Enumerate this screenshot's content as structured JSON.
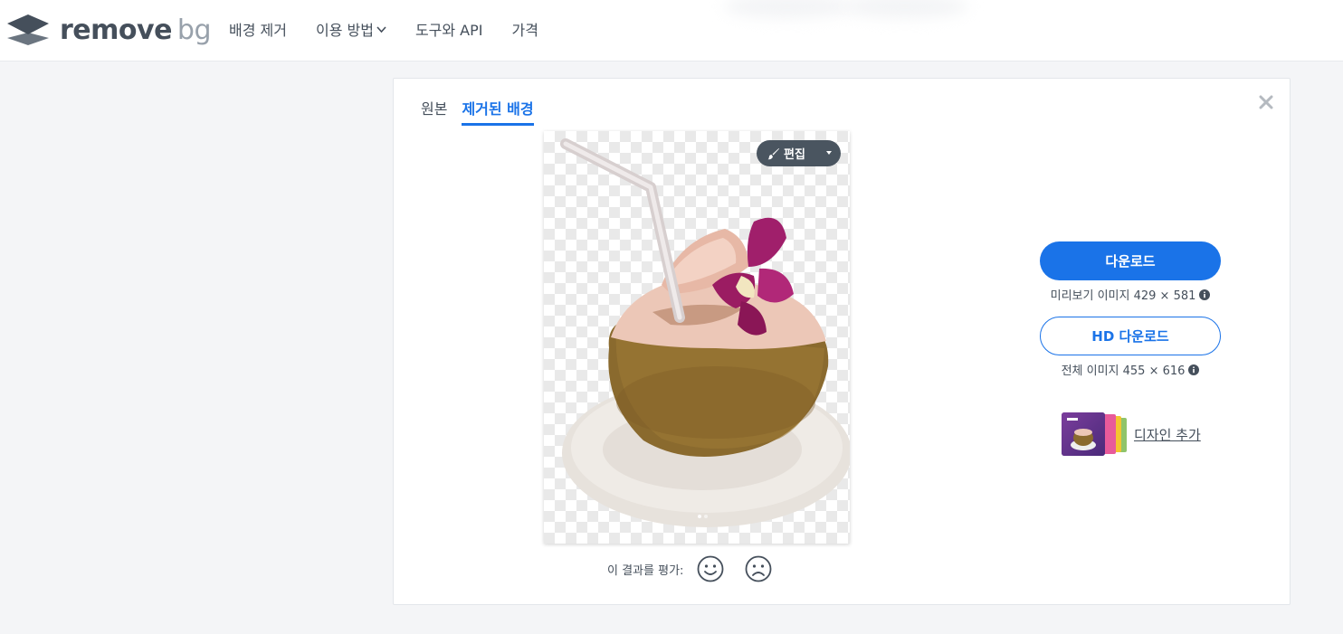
{
  "header": {
    "logo_word": "remove",
    "logo_suffix": "bg",
    "nav": [
      {
        "label": "배경 제거"
      },
      {
        "label": "이용 방법",
        "has_dropdown": true
      },
      {
        "label": "도구와 API"
      },
      {
        "label": "가격"
      }
    ]
  },
  "tabs": [
    {
      "label": "원본",
      "active": false
    },
    {
      "label": "제거된 배경",
      "active": true
    }
  ],
  "preview": {
    "edit_label": "편집"
  },
  "rating": {
    "label": "이 결과를 평가:"
  },
  "download": {
    "label": "다운로드",
    "info": "미리보기 이미지 429 × 581"
  },
  "hd_download": {
    "label": "HD 다운로드",
    "info": "전체 이미지 455 × 616"
  },
  "design": {
    "label": "디자인 추가"
  },
  "colors": {
    "accent": "#1a73e8",
    "text": "#454f5b",
    "edit_button": "#4a5560"
  },
  "icons": [
    "logo-layers-icon",
    "chevron-down-icon",
    "close-icon",
    "brush-icon",
    "caret-down-icon",
    "smile-icon",
    "frown-icon",
    "info-icon"
  ]
}
